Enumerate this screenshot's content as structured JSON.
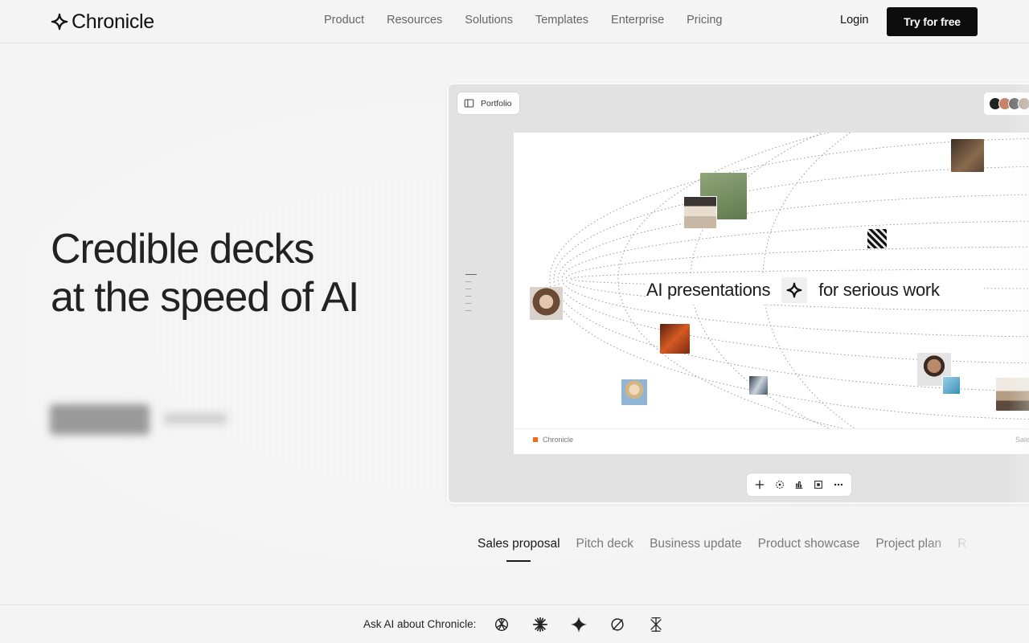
{
  "brand": {
    "name": "Chronicle"
  },
  "nav": {
    "items": [
      "Product",
      "Resources",
      "Solutions",
      "Templates",
      "Enterprise",
      "Pricing"
    ],
    "login_label": "Login",
    "cta_label": "Try for free"
  },
  "hero": {
    "title_line1": "Credible decks",
    "title_line2": "at the speed of AI"
  },
  "mockup": {
    "chip_label": "Portfolio",
    "slide_headline_left": "AI presentations",
    "slide_headline_right": "for serious work",
    "footer_brand": "Chronicle",
    "footer_right": "Sale",
    "accent_color": "#f26a1b",
    "toolbar_icons": [
      "plus-icon",
      "magic-icon",
      "chart-icon",
      "frame-icon",
      "more-icon"
    ]
  },
  "templates": {
    "tabs": [
      "Sales proposal",
      "Pitch deck",
      "Business update",
      "Product showcase",
      "Project plan",
      "R"
    ],
    "active_index": 0
  },
  "ai_bar": {
    "label": "Ask AI about Chronicle:",
    "icons": [
      "openai-icon",
      "claude-icon",
      "gemini-icon",
      "perplexity-icon",
      "grok-icon"
    ]
  }
}
